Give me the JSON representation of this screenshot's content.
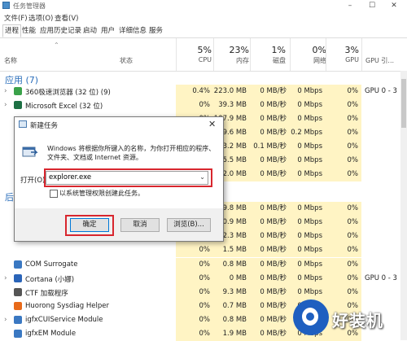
{
  "window": {
    "title": "任务管理器"
  },
  "menu": [
    "文件(F)",
    "选项(O)",
    "查看(V)"
  ],
  "tabs": [
    "进程",
    "性能",
    "应用历史记录",
    "启动",
    "用户",
    "详细信息",
    "服务"
  ],
  "active_tab": 0,
  "columns": {
    "name": "名称",
    "status": "状态",
    "cpu": {
      "pct": "5%",
      "label": "CPU"
    },
    "memory": {
      "pct": "23%",
      "label": "内存"
    },
    "disk": {
      "pct": "1%",
      "label": "磁盘"
    },
    "network": {
      "pct": "0%",
      "label": "网络"
    },
    "gpu": {
      "pct": "3%",
      "label": "GPU"
    },
    "gpu_engine": {
      "label": "GPU 引..."
    }
  },
  "section_apps": "应用 (7)",
  "section_bg": "后",
  "rows": [
    {
      "chev": "›",
      "name": "360极速浏览器 (32 位) (9)",
      "icon_color": "#3aa24a",
      "cpu": "0.4%",
      "mem": "223.0 MB",
      "disk": "0 MB/秒",
      "net": "0 Mbps",
      "gpu": "0%",
      "gpu_engine": "GPU 0 - 3"
    },
    {
      "chev": "›",
      "name": "Microsoft Excel (32 位)",
      "icon_color": "#1d7044",
      "cpu": "0%",
      "mem": "39.3 MB",
      "disk": "0 MB/秒",
      "net": "0 Mbps",
      "gpu": "0%",
      "gpu_engine": ""
    },
    {
      "chev": "",
      "name": "",
      "icon_color": "",
      "cpu": "0%",
      "mem": "107.9 MB",
      "disk": "0 MB/秒",
      "net": "0 Mbps",
      "gpu": "0%",
      "gpu_engine": ""
    },
    {
      "chev": "",
      "name": "",
      "icon_color": "",
      "cpu": "0%",
      "mem": "39.6 MB",
      "disk": "0 MB/秒",
      "net": "0.2 Mbps",
      "gpu": "0%",
      "gpu_engine": ""
    },
    {
      "chev": "",
      "name": "",
      "icon_color": "",
      "cpu": "0%",
      "mem": "103.2 MB",
      "disk": "0.1 MB/秒",
      "net": "0 Mbps",
      "gpu": "0%",
      "gpu_engine": ""
    },
    {
      "chev": "",
      "name": "",
      "icon_color": "",
      "cpu": "0%",
      "mem": "65.5 MB",
      "disk": "0 MB/秒",
      "net": "0 Mbps",
      "gpu": "0%",
      "gpu_engine": ""
    },
    {
      "chev": "",
      "name": "",
      "icon_color": "",
      "cpu": "0%",
      "mem": "32.0 MB",
      "disk": "0 MB/秒",
      "net": "0 Mbps",
      "gpu": "0%",
      "gpu_engine": ""
    },
    {
      "chev": "",
      "name": "",
      "icon_color": "",
      "cpu": "0%",
      "mem": "9.8 MB",
      "disk": "0 MB/秒",
      "net": "0 Mbps",
      "gpu": "0%",
      "gpu_engine": ""
    },
    {
      "chev": "",
      "name": "",
      "icon_color": "",
      "cpu": "0%",
      "mem": "0.9 MB",
      "disk": "0 MB/秒",
      "net": "0 Mbps",
      "gpu": "0%",
      "gpu_engine": ""
    },
    {
      "chev": "",
      "name": "",
      "icon_color": "",
      "cpu": "0%",
      "mem": "2.3 MB",
      "disk": "0 MB/秒",
      "net": "0 Mbps",
      "gpu": "0%",
      "gpu_engine": ""
    },
    {
      "chev": "",
      "name": "",
      "icon_color": "",
      "cpu": "0%",
      "mem": "1.5 MB",
      "disk": "0 MB/秒",
      "net": "0 Mbps",
      "gpu": "0%",
      "gpu_engine": ""
    },
    {
      "chev": "",
      "name": "COM Surrogate",
      "icon_color": "#3a78c2",
      "cpu": "0%",
      "mem": "0.8 MB",
      "disk": "0 MB/秒",
      "net": "0 Mbps",
      "gpu": "0%",
      "gpu_engine": ""
    },
    {
      "chev": "›",
      "name": "Cortana (小娜)",
      "icon_color": "#2a64b8",
      "cpu": "0%",
      "mem": "0 MB",
      "disk": "0 MB/秒",
      "net": "0 Mbps",
      "gpu": "0%",
      "gpu_engine": "GPU 0 - 3"
    },
    {
      "chev": "",
      "name": "CTF 加载程序",
      "icon_color": "#555",
      "cpu": "0%",
      "mem": "9.3 MB",
      "disk": "0 MB/秒",
      "net": "0 Mbps",
      "gpu": "0%",
      "gpu_engine": ""
    },
    {
      "chev": "",
      "name": "Huorong Sysdiag Helper",
      "icon_color": "#e86a1a",
      "cpu": "0%",
      "mem": "0.7 MB",
      "disk": "0 MB/秒",
      "net": "0 Mbps",
      "gpu": "0%",
      "gpu_engine": ""
    },
    {
      "chev": "›",
      "name": "igfxCUIService Module",
      "icon_color": "#3a78c2",
      "cpu": "0%",
      "mem": "0.8 MB",
      "disk": "0 MB/秒",
      "net": "0 Mbps",
      "gpu": "0%",
      "gpu_engine": ""
    },
    {
      "chev": "",
      "name": "igfxEM Module",
      "icon_color": "#3a78c2",
      "cpu": "0%",
      "mem": "1.9 MB",
      "disk": "0 MB/秒",
      "net": "0 Mbps",
      "gpu": "0%",
      "gpu_engine": ""
    }
  ],
  "dialog": {
    "title": "新建任务",
    "close": "✕",
    "description": "Windows 将根据你所键入的名称，为你打开相应的程序、文件夹、文档或 Internet 资源。",
    "open_label": "打开(O):",
    "open_value": "explorer.exe",
    "admin_checkbox": "以系统管理权限创建此任务。",
    "ok": "确定",
    "cancel": "取消",
    "browse": "浏览(B)..."
  },
  "watermark": "好装机"
}
